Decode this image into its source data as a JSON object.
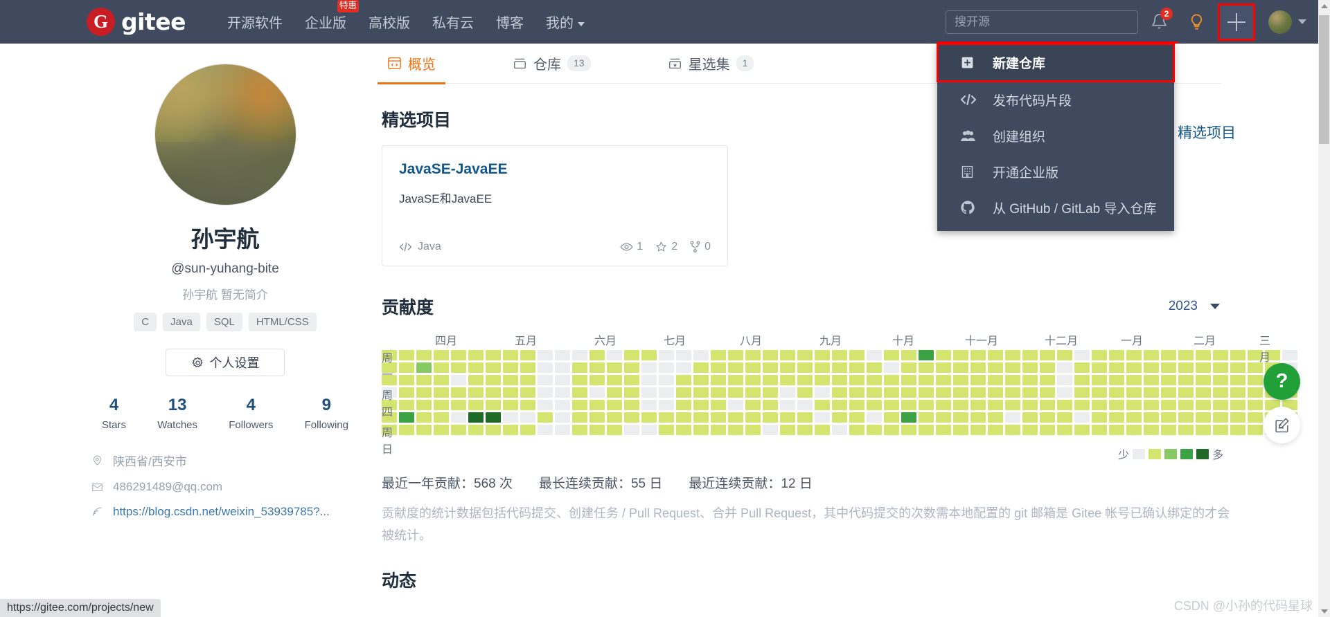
{
  "header": {
    "logo_text": "gitee",
    "logo_mark": "G",
    "nav": [
      {
        "label": "开源软件",
        "badge": null
      },
      {
        "label": "企业版",
        "badge": "特惠"
      },
      {
        "label": "高校版",
        "badge": null
      },
      {
        "label": "私有云",
        "badge": null
      },
      {
        "label": "博客",
        "badge": null
      },
      {
        "label": "我的",
        "badge": null,
        "caret": true
      }
    ],
    "search_placeholder": "搜开源",
    "notification_count": "2",
    "icons": [
      "bell-icon",
      "lightbulb-icon",
      "plus-icon",
      "avatar"
    ]
  },
  "dropdown": {
    "items": [
      {
        "label": "新建仓库",
        "icon": "new-repo-icon",
        "highlighted": true
      },
      {
        "label": "发布代码片段",
        "icon": "code-snippet-icon",
        "highlighted": false
      },
      {
        "label": "创建组织",
        "icon": "users-icon",
        "highlighted": false
      },
      {
        "label": "开通企业版",
        "icon": "building-icon",
        "highlighted": false
      },
      {
        "label": "从 GitHub / GitLab 导入仓库",
        "icon": "github-icon",
        "highlighted": false
      }
    ]
  },
  "profile": {
    "name": "孙宇航",
    "handle": "@sun-yuhang-bite",
    "bio": "孙宇航 暂无简介",
    "tags": [
      "C",
      "Java",
      "SQL",
      "HTML/CSS"
    ],
    "settings_label": "个人设置",
    "stats": [
      {
        "num": "4",
        "label": "Stars"
      },
      {
        "num": "13",
        "label": "Watches"
      },
      {
        "num": "4",
        "label": "Followers"
      },
      {
        "num": "9",
        "label": "Following"
      }
    ],
    "meta": [
      {
        "icon": "location-icon",
        "text": "陕西省/西安市",
        "link": false
      },
      {
        "icon": "mail-icon",
        "text": "486291489@qq.com",
        "link": false
      },
      {
        "icon": "rss-icon",
        "text": "https://blog.csdn.net/weixin_53939785?...",
        "link": true
      }
    ]
  },
  "tabs": [
    {
      "label": "概览",
      "count": null,
      "icon": "overview-icon",
      "active": true
    },
    {
      "label": "仓库",
      "count": "13",
      "icon": "repo-icon",
      "active": false
    },
    {
      "label": "星选集",
      "count": "1",
      "icon": "star-box-icon",
      "active": false
    }
  ],
  "featured": {
    "title": "精选项目",
    "right_panel_title": "精选项目",
    "project": {
      "name": "JavaSE-JavaEE",
      "description": "JavaSE和JavaEE",
      "language": "Java",
      "watchers": "1",
      "stars": "2",
      "forks": "0"
    }
  },
  "contributions": {
    "title": "贡献度",
    "year": "2023",
    "legend_less": "少",
    "legend_more": "多",
    "stats_line": [
      "最近一年贡献：568 次",
      "最长连续贡献：55 日",
      "最近连续贡献：12 日"
    ],
    "note": "贡献度的统计数据包括代码提交、创建任务 / Pull Request、合并 Pull Request，其中代码提交的次数需本地配置的 git 邮箱是 Gitee 帐号已确认绑定的才会被统计。",
    "day_labels": [
      "周一",
      "周四",
      "周日"
    ],
    "month_labels": [
      "四月",
      "五月",
      "六月",
      "七月",
      "八月",
      "九月",
      "十月",
      "十一月",
      "十二月",
      "一月",
      "二月",
      "三月"
    ],
    "colors": [
      "#ebedef",
      "#d3e56e",
      "#87ca63",
      "#3aa242",
      "#1d6b27"
    ],
    "chart_data": {
      "type": "heatmap",
      "title": "贡献度",
      "xlabel": "",
      "ylabel": "",
      "rows": 7,
      "cols": 53,
      "levels": [
        0,
        1,
        2,
        3,
        4
      ],
      "matrix": [
        [
          1,
          1,
          1,
          1,
          1,
          1,
          1,
          1,
          1,
          0,
          0,
          0,
          1,
          0,
          1,
          1,
          0,
          0,
          0,
          1,
          1,
          1,
          1,
          1,
          1,
          1,
          1,
          1,
          0,
          1,
          1,
          3,
          1,
          1,
          1,
          1,
          1,
          1,
          1,
          1,
          0,
          1,
          1,
          1,
          1,
          1,
          1,
          1,
          1,
          1,
          1,
          1,
          0
        ],
        [
          1,
          1,
          2,
          1,
          1,
          1,
          1,
          1,
          1,
          0,
          0,
          1,
          1,
          1,
          1,
          0,
          0,
          0,
          1,
          1,
          1,
          1,
          1,
          1,
          1,
          1,
          1,
          1,
          1,
          0,
          1,
          1,
          1,
          1,
          1,
          1,
          1,
          1,
          1,
          0,
          1,
          1,
          1,
          1,
          1,
          1,
          1,
          1,
          1,
          1,
          1,
          1,
          0
        ],
        [
          1,
          1,
          1,
          1,
          0,
          1,
          1,
          1,
          1,
          0,
          0,
          1,
          1,
          1,
          1,
          0,
          0,
          1,
          1,
          1,
          1,
          1,
          1,
          1,
          1,
          1,
          1,
          1,
          1,
          1,
          1,
          1,
          1,
          1,
          1,
          1,
          1,
          1,
          1,
          0,
          1,
          1,
          1,
          1,
          1,
          1,
          1,
          1,
          1,
          1,
          1,
          1,
          1
        ],
        [
          0,
          1,
          1,
          1,
          1,
          1,
          1,
          1,
          1,
          0,
          0,
          1,
          0,
          1,
          1,
          0,
          0,
          1,
          1,
          1,
          1,
          1,
          1,
          0,
          1,
          0,
          1,
          1,
          1,
          1,
          1,
          1,
          1,
          1,
          1,
          1,
          1,
          1,
          1,
          0,
          1,
          1,
          1,
          1,
          1,
          1,
          1,
          1,
          1,
          1,
          1,
          1,
          1
        ],
        [
          1,
          1,
          1,
          1,
          1,
          1,
          1,
          1,
          1,
          0,
          0,
          1,
          1,
          1,
          1,
          0,
          0,
          1,
          1,
          1,
          0,
          1,
          1,
          0,
          0,
          1,
          1,
          1,
          1,
          1,
          1,
          1,
          1,
          1,
          1,
          1,
          1,
          1,
          1,
          1,
          1,
          1,
          1,
          1,
          1,
          1,
          1,
          1,
          1,
          1,
          1,
          1,
          1
        ],
        [
          1,
          3,
          1,
          1,
          0,
          4,
          4,
          0,
          0,
          1,
          0,
          1,
          1,
          1,
          1,
          1,
          1,
          1,
          1,
          1,
          1,
          1,
          1,
          1,
          1,
          0,
          1,
          1,
          0,
          1,
          3,
          1,
          1,
          1,
          1,
          1,
          0,
          1,
          1,
          1,
          0,
          1,
          1,
          1,
          1,
          1,
          1,
          1,
          1,
          1,
          1,
          1,
          1
        ],
        [
          1,
          1,
          1,
          1,
          1,
          1,
          1,
          1,
          1,
          0,
          0,
          1,
          1,
          1,
          0,
          0,
          1,
          1,
          1,
          1,
          1,
          1,
          0,
          1,
          1,
          1,
          0,
          1,
          1,
          1,
          1,
          1,
          1,
          1,
          1,
          1,
          1,
          1,
          1,
          1,
          1,
          1,
          1,
          1,
          1,
          1,
          1,
          1,
          1,
          1,
          1,
          0,
          0
        ]
      ]
    }
  },
  "dynamic": {
    "title": "动态"
  },
  "floating": {
    "help_label": "?",
    "feedback_icon": "feedback-icon"
  },
  "statusbar": {
    "url": "https://gitee.com/projects/new"
  },
  "watermark": {
    "text": "CSDN @小孙的代码星球"
  }
}
